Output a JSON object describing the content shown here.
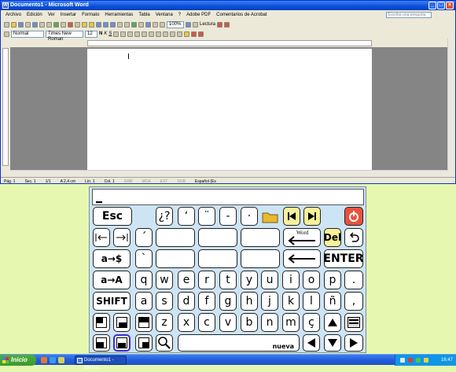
{
  "word": {
    "title": "Documento1 - Microsoft Word",
    "menus": [
      "Archivo",
      "Edición",
      "Ver",
      "Insertar",
      "Formato",
      "Herramientas",
      "Tabla",
      "Ventana",
      "?",
      "Adobe PDF",
      "Comentarios de Acrobat"
    ],
    "help_placeholder": "Escriba una pregunta",
    "style": "Normal",
    "font": "Times New Roman",
    "size": "12",
    "zoom": "100%",
    "read_label": "Lectura",
    "status": {
      "page": "Pág. 1",
      "section": "Sec. 1",
      "pages": "1/1",
      "at": "A 2,4 cm",
      "line": "Lín. 1",
      "col": "Col. 1",
      "rec": "GRB",
      "trk": "MCA",
      "ext": "EXT",
      "ovr": "SOB",
      "lang": "Español (Es"
    }
  },
  "keyboard": {
    "row0": [
      "Esc",
      "¿?",
      "‘",
      "¨",
      "-",
      "·"
    ],
    "row2": [
      "´"
    ],
    "row3": [
      "a→$",
      "`"
    ],
    "row4": [
      "a→A",
      "q",
      "w",
      "e",
      "r",
      "t",
      "y",
      "u",
      "i",
      "o",
      "p",
      "."
    ],
    "row5": [
      "SHIFT",
      "a",
      "s",
      "d",
      "f",
      "g",
      "h",
      "j",
      "k",
      "l",
      "ñ",
      ","
    ],
    "row6": [
      "z",
      "x",
      "c",
      "v",
      "b",
      "n",
      "m",
      "ç"
    ],
    "word_label": "Word",
    "del_label": "Del",
    "enter_label": "ENTER",
    "space_label": "nueva",
    "colors": {
      "yellow": "#f8f09a",
      "red": "#e8523c",
      "panel": "#cde4f4"
    }
  },
  "taskbar": {
    "start_label": "Inicio",
    "task_label": "Documento1 - Micros...",
    "clock": "16:47"
  }
}
